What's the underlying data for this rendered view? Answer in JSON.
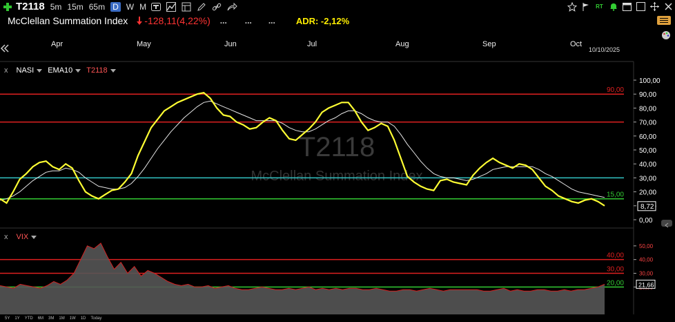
{
  "toolbar": {
    "symbol": "T2118",
    "intervals": [
      "5m",
      "15m",
      "65m",
      "D",
      "W",
      "M"
    ],
    "active_interval": "D"
  },
  "info": {
    "name": "McClellan Summation Index",
    "change": "-128,11",
    "change_pct": "(4,22%)",
    "dots": [
      "...",
      "...",
      "..."
    ],
    "adr": "ADR: -2,12%"
  },
  "timeline": {
    "months": [
      "Apr",
      "May",
      "Jun",
      "Jul",
      "Aug",
      "Sep",
      "Oct"
    ],
    "date": "10/10/2025"
  },
  "bottom_ranges": [
    "5Y",
    "1Y",
    "YTD",
    "6M",
    "3M",
    "1M",
    "1W",
    "1D",
    "Today"
  ],
  "colors": {
    "summation": "#ffff33",
    "ema": "#e6e6e6",
    "line_red": "#e02020",
    "line_cyan": "#33c5c5",
    "line_green": "#33cc33",
    "vix_area": "#555555",
    "vix_line": "#d42020"
  },
  "chart_data": [
    {
      "type": "line",
      "watermark": "T2118",
      "watermark_sub": "McClellan Summation Index",
      "legend": [
        "NASI",
        "EMA10",
        "T2118"
      ],
      "ylim": [
        0,
        100
      ],
      "y_ticks": [
        "100,00",
        "90,00",
        "80,00",
        "70,00",
        "60,00",
        "50,00",
        "40,00",
        "30,00",
        "20,00",
        "10,00",
        "0,00"
      ],
      "reference_lines": [
        {
          "value": 90,
          "label": "90,00",
          "color": "#e02020"
        },
        {
          "value": 70,
          "label": "",
          "color": "#e02020"
        },
        {
          "value": 30,
          "label": "",
          "color": "#33c5c5"
        },
        {
          "value": 15,
          "label": "15,00",
          "color": "#33cc33"
        }
      ],
      "last_value": "8,72",
      "series": [
        {
          "values": [
            15,
            12,
            20,
            29,
            33,
            38,
            41,
            42,
            38,
            36,
            40,
            37,
            28,
            20,
            17,
            15,
            18,
            21,
            22,
            27,
            33,
            46,
            56,
            66,
            72,
            78,
            81,
            84,
            86,
            88,
            90,
            91,
            87,
            80,
            75,
            74,
            70,
            68,
            65,
            66,
            70,
            73,
            71,
            64,
            58,
            57,
            61,
            65,
            70,
            77,
            80,
            82,
            84,
            84,
            78,
            70,
            64,
            66,
            69,
            67,
            57,
            44,
            31,
            27,
            24,
            22,
            21,
            28,
            29,
            27,
            26,
            25,
            32,
            37,
            41,
            44,
            41,
            39,
            37,
            40,
            39,
            36,
            30,
            24,
            21,
            17,
            15,
            13,
            12,
            14,
            15,
            13,
            10
          ]
        },
        {
          "values": [
            14,
            15,
            17,
            20,
            24,
            28,
            31,
            34,
            35,
            35,
            37,
            36,
            34,
            30,
            27,
            24,
            23,
            22,
            22,
            23,
            26,
            31,
            37,
            44,
            51,
            57,
            63,
            68,
            73,
            77,
            81,
            84,
            85,
            83,
            81,
            79,
            77,
            75,
            73,
            71,
            71,
            71,
            71,
            69,
            66,
            64,
            63,
            63,
            65,
            68,
            71,
            73,
            76,
            78,
            78,
            76,
            73,
            71,
            70,
            70,
            67,
            61,
            54,
            48,
            42,
            37,
            33,
            31,
            30,
            30,
            29,
            28,
            29,
            31,
            33,
            36,
            37,
            38,
            38,
            38,
            38,
            38,
            36,
            33,
            31,
            28,
            25,
            22,
            20,
            19,
            18,
            17,
            16
          ]
        }
      ]
    },
    {
      "type": "area",
      "legend": [
        "VIX"
      ],
      "ylim": [
        0,
        60
      ],
      "y_ticks": [
        "50,00",
        "40,00",
        "30,00",
        "20,00"
      ],
      "reference_lines": [
        {
          "value": 40,
          "label": "40,00",
          "color": "#e02020"
        },
        {
          "value": 30,
          "label": "30,00",
          "color": "#e02020"
        },
        {
          "value": 20,
          "label": "20,00",
          "color": "#33cc33"
        }
      ],
      "last_value": "21,66",
      "series": [
        {
          "values": [
            21,
            20,
            19,
            22,
            21,
            20,
            19,
            21,
            24,
            22,
            25,
            30,
            40,
            50,
            48,
            52,
            42,
            33,
            38,
            30,
            35,
            28,
            32,
            30,
            27,
            24,
            22,
            21,
            22,
            20,
            20,
            21,
            19,
            20,
            21,
            19,
            18,
            18,
            19,
            20,
            19,
            18,
            18,
            19,
            18,
            19,
            20,
            18,
            19,
            18,
            19,
            18,
            19,
            19,
            18,
            18,
            19,
            18,
            17,
            17,
            18,
            18,
            17,
            18,
            19,
            18,
            17,
            18,
            18,
            18,
            18,
            18,
            17,
            17,
            18,
            19,
            17,
            18,
            17,
            17,
            18,
            18,
            17,
            17,
            18,
            17,
            18,
            18,
            19,
            20,
            22
          ]
        }
      ]
    }
  ]
}
